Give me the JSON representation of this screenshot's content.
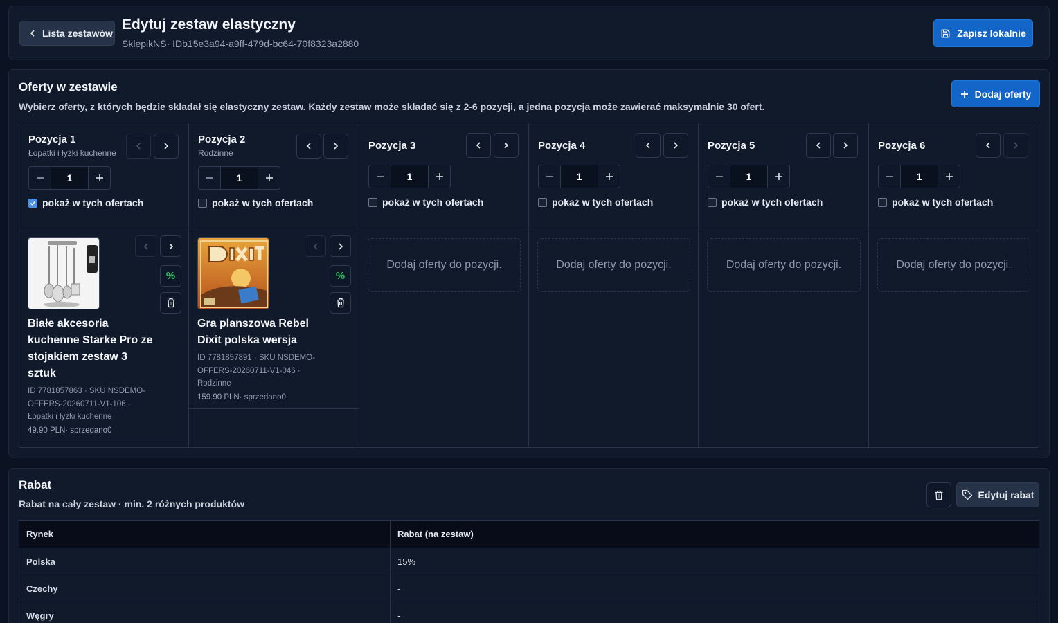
{
  "header": {
    "back_label": "Lista zestawów",
    "title": "Edytuj zestaw elastyczny",
    "subtitle": "SklepikNS· IDb15e3a94-a9ff-479d-bc64-70f8323a2880",
    "save_label": "Zapisz lokalnie"
  },
  "offers": {
    "title": "Oferty w zestawie",
    "description": "Wybierz oferty, z których będzie składał się elastyczny zestaw. Każdy zestaw może składać się z 2-6 pozycji, a jedna pozycja może zawierać maksymalnie 30 ofert.",
    "add_label": "Dodaj oferty",
    "show_label": "pokaż w tych ofertach",
    "empty_label": "Dodaj oferty do pozycji.",
    "positions": [
      {
        "title": "Pozycja 1",
        "subtitle": "Łopatki i łyżki kuchenne",
        "qty": "1",
        "checked": true,
        "offer": {
          "name_lines": [
            "Białe akcesoria",
            "kuchenne Starke Pro ze",
            "stojakiem zestaw 3",
            "sztuk"
          ],
          "meta_lines": [
            "ID 7781857863 · SKU NSDEMO-",
            "OFFERS-20260711-V1-106 ·",
            "Łopatki i łyżki kuchenne"
          ],
          "price": "49.90 PLN· sprzedano0"
        }
      },
      {
        "title": "Pozycja 2",
        "subtitle": "Rodzinne",
        "qty": "1",
        "checked": false,
        "offer": {
          "name_lines": [
            "Gra planszowa Rebel",
            "Dixit polska wersja"
          ],
          "meta_lines": [
            "ID 7781857891 · SKU NSDEMO-",
            "OFFERS-20260711-V1-046 ·",
            "Rodzinne"
          ],
          "price": "159.90 PLN· sprzedano0"
        }
      },
      {
        "title": "Pozycja 3",
        "subtitle": "",
        "qty": "1",
        "checked": false
      },
      {
        "title": "Pozycja 4",
        "subtitle": "",
        "qty": "1",
        "checked": false
      },
      {
        "title": "Pozycja 5",
        "subtitle": "",
        "qty": "1",
        "checked": false
      },
      {
        "title": "Pozycja 6",
        "subtitle": "",
        "qty": "1",
        "checked": false
      }
    ]
  },
  "rabat": {
    "title": "Rabat",
    "description": "Rabat na cały zestaw · min. 2 różnych produktów",
    "edit_label": "Edytuj rabat",
    "columns": [
      "Rynek",
      "Rabat (na zestaw)"
    ],
    "rows": [
      {
        "market": "Polska",
        "value": "15%"
      },
      {
        "market": "Czechy",
        "value": "-"
      },
      {
        "market": "Węgry",
        "value": "-"
      }
    ]
  },
  "colors": {
    "accent": "#1366c7",
    "background": "#0b1322",
    "card": "#111a2b",
    "success": "#2fbf60"
  }
}
